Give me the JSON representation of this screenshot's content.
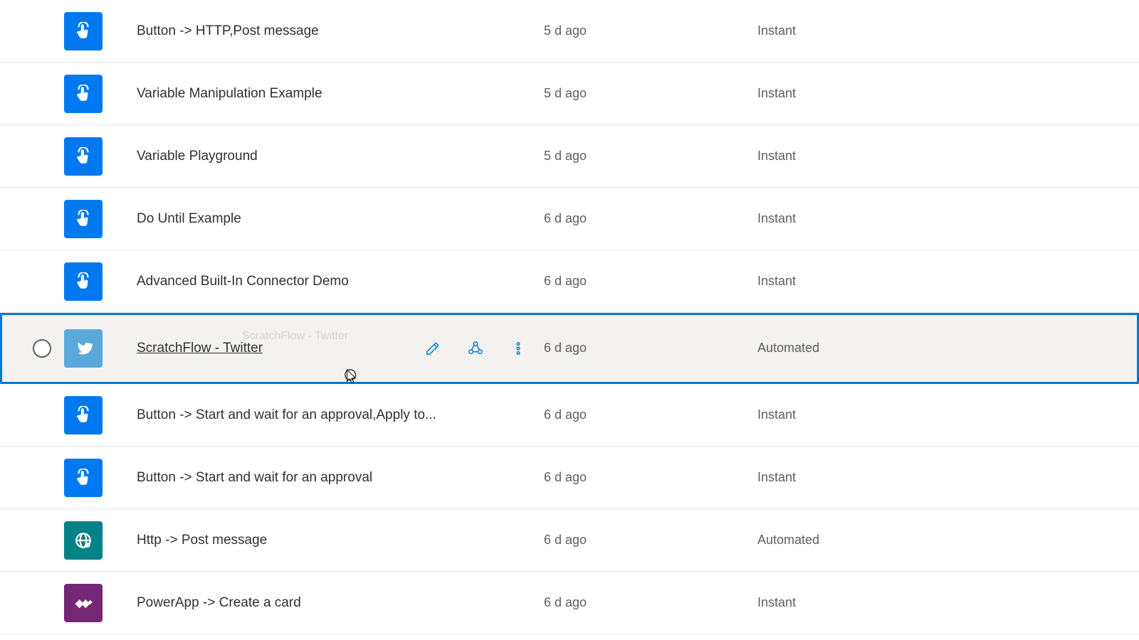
{
  "flows": [
    {
      "name": "Button -> HTTP,Post message",
      "modified": "5 d ago",
      "type": "Instant",
      "icon": "tap",
      "color": "blue",
      "highlighted": false
    },
    {
      "name": "Variable Manipulation Example",
      "modified": "5 d ago",
      "type": "Instant",
      "icon": "tap",
      "color": "blue",
      "highlighted": false
    },
    {
      "name": "Variable Playground",
      "modified": "5 d ago",
      "type": "Instant",
      "icon": "tap",
      "color": "blue",
      "highlighted": false
    },
    {
      "name": "Do Until Example",
      "modified": "6 d ago",
      "type": "Instant",
      "icon": "tap",
      "color": "blue",
      "highlighted": false
    },
    {
      "name": "Advanced Built-In Connector Demo",
      "modified": "6 d ago",
      "type": "Instant",
      "icon": "tap",
      "color": "blue",
      "highlighted": false
    },
    {
      "name": "ScratchFlow - Twitter",
      "modified": "6 d ago",
      "type": "Automated",
      "icon": "twitter",
      "color": "twitter",
      "highlighted": true
    },
    {
      "name": "Button -> Start and wait for an approval,Apply to...",
      "modified": "6 d ago",
      "type": "Instant",
      "icon": "tap",
      "color": "blue",
      "highlighted": false
    },
    {
      "name": "Button -> Start and wait for an approval",
      "modified": "6 d ago",
      "type": "Instant",
      "icon": "tap",
      "color": "blue",
      "highlighted": false
    },
    {
      "name": "Http -> Post message",
      "modified": "6 d ago",
      "type": "Automated",
      "icon": "globe",
      "color": "teal",
      "highlighted": false
    },
    {
      "name": "PowerApp -> Create a card",
      "modified": "6 d ago",
      "type": "Instant",
      "icon": "diamond",
      "color": "purple",
      "highlighted": false
    }
  ],
  "ghost_text": "ScratchFlow - Twitter"
}
